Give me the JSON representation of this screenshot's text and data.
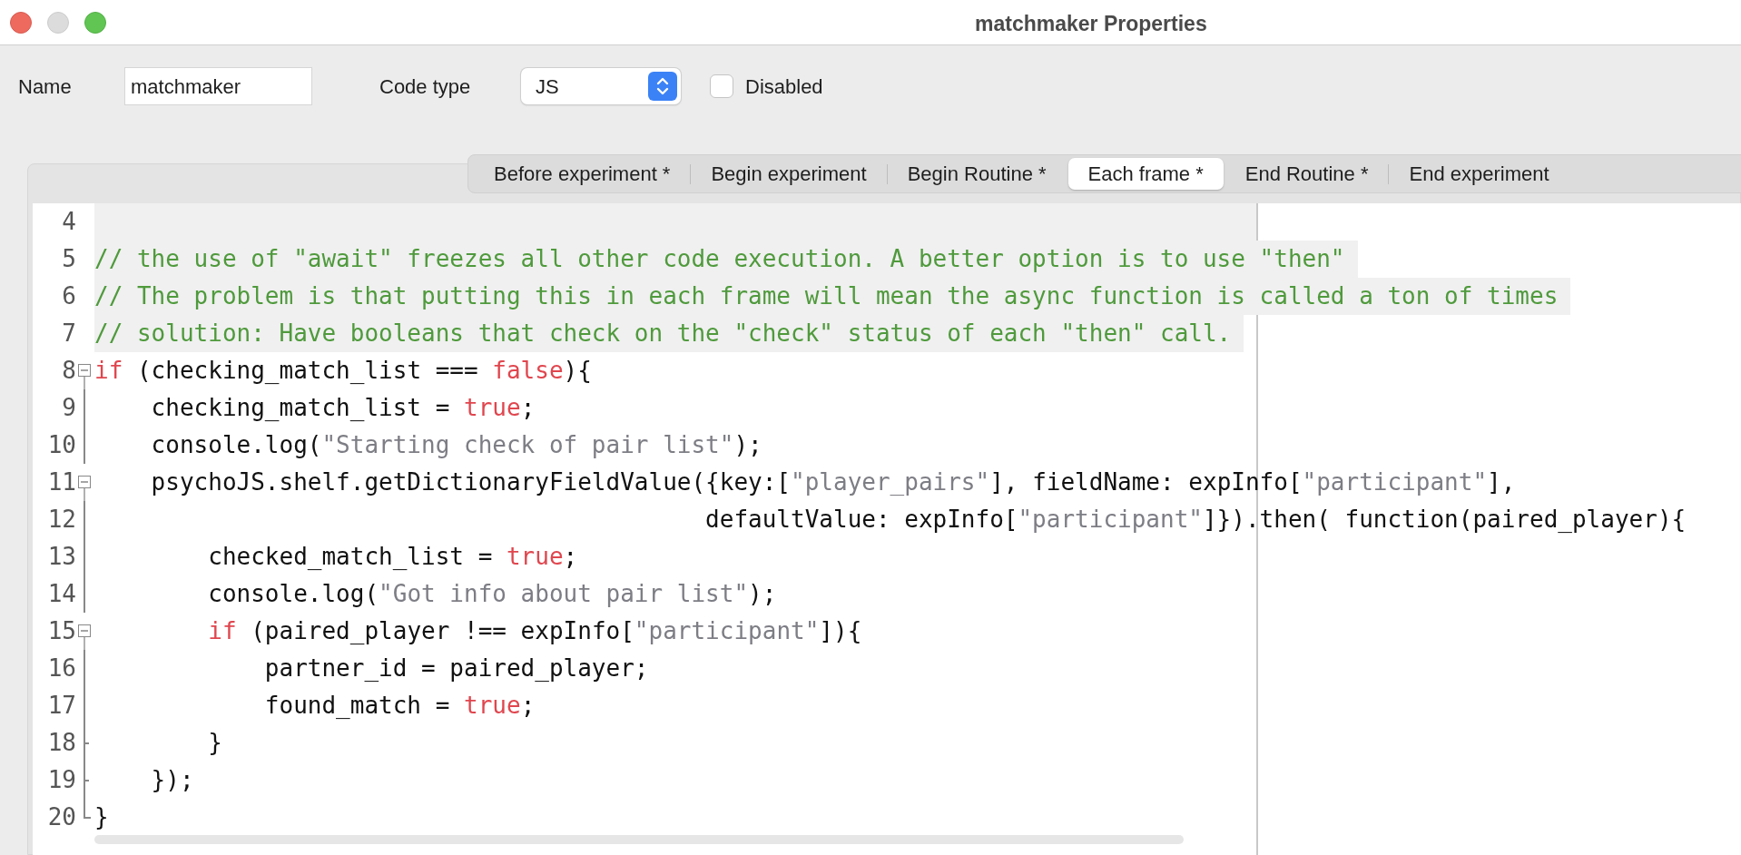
{
  "window": {
    "title": "matchmaker Properties"
  },
  "form": {
    "name_label": "Name",
    "name_value": "matchmaker",
    "code_type_label": "Code type",
    "code_type_value": "JS",
    "disabled_label": "Disabled",
    "disabled_checked": false
  },
  "tabs": [
    {
      "label": "Before experiment *",
      "selected": false
    },
    {
      "label": "Begin experiment",
      "selected": false
    },
    {
      "label": "Begin Routine *",
      "selected": false
    },
    {
      "label": "Each frame *",
      "selected": true
    },
    {
      "label": "End Routine *",
      "selected": false
    },
    {
      "label": "End experiment",
      "selected": false
    }
  ],
  "editor": {
    "lines": [
      {
        "number": "4",
        "kind": "plain",
        "shaded": true
      },
      {
        "number": "5",
        "kind": "plain",
        "shaded": true,
        "tokens": [
          {
            "kind": "comment",
            "text": "// the use of \"await\" freezes all other code execution. A better option is to use \"then\""
          }
        ]
      },
      {
        "number": "6",
        "kind": "plain",
        "shaded": true,
        "tokens": [
          {
            "kind": "comment",
            "text": "// The problem is that putting this in each frame will mean the async function is called a ton of times"
          }
        ]
      },
      {
        "number": "7",
        "kind": "plain",
        "shaded": true,
        "tokens": [
          {
            "kind": "comment",
            "text": "// solution: Have booleans that check on the \"check\" status of each \"then\" call."
          }
        ]
      },
      {
        "number": "8",
        "kind": "foldstart",
        "shaded": false,
        "tokens": [
          {
            "kind": "keyword",
            "text": "if"
          },
          {
            "kind": "plain",
            "text": " (checking_match_list === "
          },
          {
            "kind": "keyword",
            "text": "false"
          },
          {
            "kind": "plain",
            "text": "){"
          }
        ]
      },
      {
        "number": "9",
        "kind": "foldbody",
        "shaded": false,
        "tokens": [
          {
            "kind": "plain",
            "text": "    checking_match_list = "
          },
          {
            "kind": "keyword",
            "text": "true"
          },
          {
            "kind": "plain",
            "text": ";"
          }
        ]
      },
      {
        "number": "10",
        "kind": "foldbody",
        "shaded": false,
        "tokens": [
          {
            "kind": "plain",
            "text": "    console.log("
          },
          {
            "kind": "string",
            "text": "\"Starting check of pair list\""
          },
          {
            "kind": "plain",
            "text": ");"
          }
        ]
      },
      {
        "number": "11",
        "kind": "foldstart",
        "shaded": false,
        "tokens": [
          {
            "kind": "plain",
            "text": "    psychoJS.shelf.getDictionaryFieldValue({key:["
          },
          {
            "kind": "string",
            "text": "\"player_pairs\""
          },
          {
            "kind": "plain",
            "text": "], fieldName: expInfo["
          },
          {
            "kind": "string",
            "text": "\"participant\""
          },
          {
            "kind": "plain",
            "text": "],"
          }
        ]
      },
      {
        "number": "12",
        "kind": "foldbody",
        "shaded": false,
        "tokens": [
          {
            "kind": "plain",
            "text": "                                           defaultValue: expInfo["
          },
          {
            "kind": "string",
            "text": "\"participant\""
          },
          {
            "kind": "plain",
            "text": "]}).then( function(paired_player){"
          }
        ]
      },
      {
        "number": "13",
        "kind": "foldbody",
        "shaded": false,
        "tokens": [
          {
            "kind": "plain",
            "text": "        checked_match_list = "
          },
          {
            "kind": "keyword",
            "text": "true"
          },
          {
            "kind": "plain",
            "text": ";"
          }
        ]
      },
      {
        "number": "14",
        "kind": "foldbody",
        "shaded": false,
        "tokens": [
          {
            "kind": "plain",
            "text": "        console.log("
          },
          {
            "kind": "string",
            "text": "\"Got info about pair list\""
          },
          {
            "kind": "plain",
            "text": ");"
          }
        ]
      },
      {
        "number": "15",
        "kind": "foldstart",
        "shaded": false,
        "tokens": [
          {
            "kind": "keyword",
            "text": "        if"
          },
          {
            "kind": "plain",
            "text": " (paired_player !== expInfo["
          },
          {
            "kind": "string",
            "text": "\"participant\""
          },
          {
            "kind": "plain",
            "text": "]){"
          }
        ]
      },
      {
        "number": "16",
        "kind": "foldbody",
        "shaded": false,
        "tokens": [
          {
            "kind": "plain",
            "text": "            partner_id = paired_player;"
          }
        ]
      },
      {
        "number": "17",
        "kind": "foldbody",
        "shaded": false,
        "tokens": [
          {
            "kind": "plain",
            "text": "            found_match = "
          },
          {
            "kind": "keyword",
            "text": "true"
          },
          {
            "kind": "plain",
            "text": ";"
          }
        ]
      },
      {
        "number": "18",
        "kind": "foldend",
        "shaded": false,
        "tokens": [
          {
            "kind": "plain",
            "text": "        }"
          }
        ]
      },
      {
        "number": "19",
        "kind": "foldend",
        "shaded": false,
        "tokens": [
          {
            "kind": "plain",
            "text": "    });"
          }
        ]
      },
      {
        "number": "20",
        "kind": "foldlast",
        "shaded": false,
        "tokens": [
          {
            "kind": "plain",
            "text": "}"
          }
        ]
      }
    ]
  }
}
